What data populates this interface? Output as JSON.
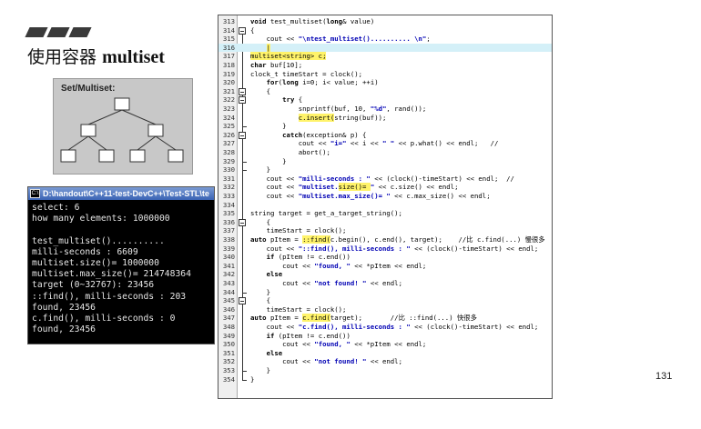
{
  "slide": {
    "title_cn": "使用容器",
    "title_en": "multiset",
    "diagram_label": "Set/Multiset:",
    "page_number": "131"
  },
  "console": {
    "title": "D:\\handout\\C++11-test-DevC++\\Test-STL\\te",
    "lines": [
      "select: 6",
      "how many elements: 1000000",
      "",
      "test_multiset()..........",
      "milli-seconds : 6609",
      "multiset.size()= 1000000",
      "multiset.max_size()= 214748364",
      "target (0~32767): 23456",
      "::find(), milli-seconds : 203",
      "found, 23456",
      "c.find(), milli-seconds : 0",
      "found, 23456"
    ]
  },
  "code": {
    "lines": [
      {
        "n": "313",
        "segs": [
          {
            "t": "void",
            "k": "kw"
          },
          {
            "t": " test_multiset("
          },
          {
            "t": "long",
            "k": "kw"
          },
          {
            "t": "& value)"
          }
        ]
      },
      {
        "n": "314",
        "segs": [
          {
            "t": "{"
          }
        ]
      },
      {
        "n": "315",
        "segs": [
          {
            "t": "    cout << "
          },
          {
            "t": "\"\\ntest_multiset().......... \\n\"",
            "k": "str"
          },
          {
            "t": ";"
          }
        ]
      },
      {
        "n": "316",
        "segs": [
          {
            "t": "    "
          },
          {
            "t": "|",
            "k": "mk"
          }
        ],
        "hl": true
      },
      {
        "n": "317",
        "segs": [
          {
            "t": "multiset<string> c;",
            "k": "mk"
          }
        ]
      },
      {
        "n": "318",
        "segs": [
          {
            "t": "char",
            "k": "kw"
          },
          {
            "t": " buf[10];"
          }
        ]
      },
      {
        "n": "319",
        "segs": [
          {
            "t": "clock_t timeStart = clock();"
          }
        ]
      },
      {
        "n": "320",
        "segs": [
          {
            "t": "    "
          },
          {
            "t": "for",
            "k": "kw"
          },
          {
            "t": "("
          },
          {
            "t": "long",
            "k": "kw"
          },
          {
            "t": " i=0; i< value; ++i)"
          }
        ]
      },
      {
        "n": "321",
        "segs": [
          {
            "t": "    {"
          }
        ]
      },
      {
        "n": "322",
        "segs": [
          {
            "t": "        "
          },
          {
            "t": "try",
            "k": "kw"
          },
          {
            "t": " {"
          }
        ]
      },
      {
        "n": "323",
        "segs": [
          {
            "t": "            snprintf(buf, 10, "
          },
          {
            "t": "\"%d\"",
            "k": "str"
          },
          {
            "t": ", rand());"
          }
        ]
      },
      {
        "n": "324",
        "segs": [
          {
            "t": "            "
          },
          {
            "t": "c.insert(",
            "k": "mk"
          },
          {
            "t": "string(buf));"
          }
        ]
      },
      {
        "n": "325",
        "segs": [
          {
            "t": "        }"
          }
        ]
      },
      {
        "n": "326",
        "segs": [
          {
            "t": "        "
          },
          {
            "t": "catch",
            "k": "kw"
          },
          {
            "t": "(exception& p) {"
          }
        ]
      },
      {
        "n": "327",
        "segs": [
          {
            "t": "            cout << "
          },
          {
            "t": "\"i=\"",
            "k": "str"
          },
          {
            "t": " << i << "
          },
          {
            "t": "\" \"",
            "k": "str"
          },
          {
            "t": " << p.what() << endl;   //"
          }
        ]
      },
      {
        "n": "328",
        "segs": [
          {
            "t": "            abort();"
          }
        ]
      },
      {
        "n": "329",
        "segs": [
          {
            "t": "        }"
          }
        ]
      },
      {
        "n": "330",
        "segs": [
          {
            "t": "    }"
          }
        ]
      },
      {
        "n": "331",
        "segs": [
          {
            "t": "    cout << "
          },
          {
            "t": "\"milli-seconds : \"",
            "k": "str"
          },
          {
            "t": " << (clock()-timeStart) << endl;  //"
          }
        ]
      },
      {
        "n": "332",
        "segs": [
          {
            "t": "    cout << "
          },
          {
            "t": "\"multiset.",
            "k": "str"
          },
          {
            "t": "size()= ",
            "k": "mk"
          },
          {
            "t": "\"",
            "k": "str"
          },
          {
            "t": " << c.size() << endl;"
          }
        ]
      },
      {
        "n": "333",
        "segs": [
          {
            "t": "    cout << "
          },
          {
            "t": "\"multiset.max_size()= \"",
            "k": "str"
          },
          {
            "t": " << c.max_size() << endl;"
          }
        ]
      },
      {
        "n": "334",
        "segs": [
          {
            "t": ""
          }
        ]
      },
      {
        "n": "335",
        "segs": [
          {
            "t": "string target = get_a_target_string();"
          }
        ]
      },
      {
        "n": "336",
        "segs": [
          {
            "t": "    {"
          }
        ]
      },
      {
        "n": "337",
        "segs": [
          {
            "t": "    timeStart = clock();"
          }
        ]
      },
      {
        "n": "338",
        "segs": [
          {
            "t": "auto",
            "k": "kw"
          },
          {
            "t": " pItem = "
          },
          {
            "t": "::find(",
            "k": "mk"
          },
          {
            "t": "c.begin(), c.end(), target);    //比 c.find(...) 慢很多"
          }
        ]
      },
      {
        "n": "339",
        "segs": [
          {
            "t": "    cout << "
          },
          {
            "t": "\"::find(), milli-seconds : \"",
            "k": "str"
          },
          {
            "t": " << (clock()-timeStart) << endl;"
          }
        ]
      },
      {
        "n": "340",
        "segs": [
          {
            "t": "    "
          },
          {
            "t": "if",
            "k": "kw"
          },
          {
            "t": " (pItem != c.end())"
          }
        ]
      },
      {
        "n": "341",
        "segs": [
          {
            "t": "        cout << "
          },
          {
            "t": "\"found, \"",
            "k": "str"
          },
          {
            "t": " << *pItem << endl;"
          }
        ]
      },
      {
        "n": "342",
        "segs": [
          {
            "t": "    "
          },
          {
            "t": "else",
            "k": "kw"
          }
        ]
      },
      {
        "n": "343",
        "segs": [
          {
            "t": "        cout << "
          },
          {
            "t": "\"not found! \"",
            "k": "str"
          },
          {
            "t": " << endl;"
          }
        ]
      },
      {
        "n": "344",
        "segs": [
          {
            "t": "    }"
          }
        ]
      },
      {
        "n": "345",
        "segs": [
          {
            "t": "    {"
          }
        ]
      },
      {
        "n": "346",
        "segs": [
          {
            "t": "    timeStart = clock();"
          }
        ]
      },
      {
        "n": "347",
        "segs": [
          {
            "t": "auto",
            "k": "kw"
          },
          {
            "t": " pItem = "
          },
          {
            "t": "c.find(",
            "k": "mk"
          },
          {
            "t": "target);       //比 ::find(...) 快很多"
          }
        ]
      },
      {
        "n": "348",
        "segs": [
          {
            "t": "    cout << "
          },
          {
            "t": "\"c.find(), milli-seconds : \"",
            "k": "str"
          },
          {
            "t": " << (clock()-timeStart) << endl;"
          }
        ]
      },
      {
        "n": "349",
        "segs": [
          {
            "t": "    "
          },
          {
            "t": "if",
            "k": "kw"
          },
          {
            "t": " (pItem != c.end())"
          }
        ]
      },
      {
        "n": "350",
        "segs": [
          {
            "t": "        cout << "
          },
          {
            "t": "\"found, \"",
            "k": "str"
          },
          {
            "t": " << *pItem << endl;"
          }
        ]
      },
      {
        "n": "351",
        "segs": [
          {
            "t": "    "
          },
          {
            "t": "else",
            "k": "kw"
          }
        ]
      },
      {
        "n": "352",
        "segs": [
          {
            "t": "        cout << "
          },
          {
            "t": "\"not found! \"",
            "k": "str"
          },
          {
            "t": " << endl;"
          }
        ]
      },
      {
        "n": "353",
        "segs": [
          {
            "t": "    }"
          }
        ]
      },
      {
        "n": "354",
        "segs": [
          {
            "t": "}"
          }
        ]
      }
    ]
  }
}
